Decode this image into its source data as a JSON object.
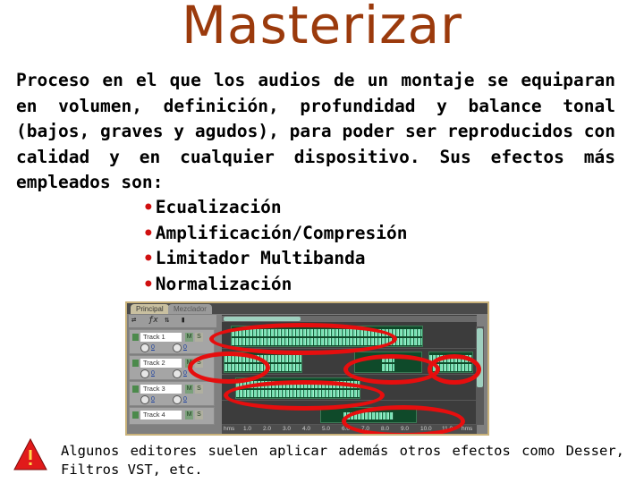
{
  "title": "Masterizar",
  "paragraph": "Proceso en el que los audios de un montaje se equiparan en volumen, definición, profundidad y balance tonal (bajos, graves y agudos), para poder ser reproducidos con calidad y en cualquier dispositivo. Sus efectos más empleados son:",
  "effects": [
    "Ecualización",
    "Amplificación/Compresión",
    "Limitador Multibanda",
    "Normalización"
  ],
  "bullet_color": "#d01010",
  "title_color": "#9b3a0c",
  "screenshot": {
    "tabs": [
      "Principal",
      "Mezclador"
    ],
    "tracks": [
      {
        "name": "Track 1",
        "mute": "M",
        "solo": "S",
        "volume": "0",
        "pan": "0"
      },
      {
        "name": "Track 2",
        "mute": "M",
        "solo": "S",
        "volume": "0",
        "pan": "0"
      },
      {
        "name": "Track 3",
        "mute": "M",
        "solo": "S",
        "volume": "0",
        "pan": "0"
      },
      {
        "name": "Track 4",
        "mute": "M",
        "solo": "S",
        "volume": "",
        "pan": ""
      }
    ],
    "ruler": [
      "hms",
      "1.0",
      "2.0",
      "3.0",
      "4.0",
      "5.0",
      "6.0",
      "7.0",
      "8.0",
      "9.0",
      "10.0",
      "11.0",
      "hms"
    ],
    "highlight_color": "#e60e0e",
    "waveform_color": "#7ff0c0"
  },
  "warning": {
    "icon": "warning-triangle-icon",
    "text": "Algunos editores suelen aplicar además otros efectos como Desser, Filtros VST, etc."
  }
}
